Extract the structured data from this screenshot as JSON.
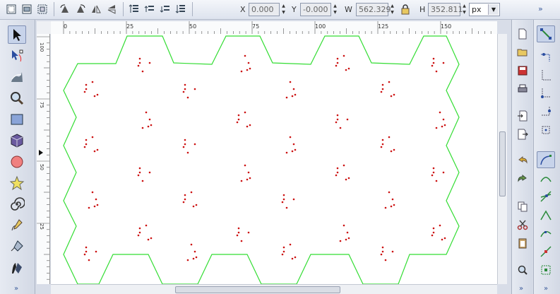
{
  "toolbar": {
    "x_label": "X",
    "x_value": "0.000",
    "y_label": "Y",
    "y_value": "-0.000",
    "w_label": "W",
    "w_value": "562.329",
    "h_label": "H",
    "h_value": "352.811",
    "unit": "px",
    "overflow": "»"
  },
  "ruler": {
    "top_labels": [
      "0",
      "25",
      "50",
      "75",
      "100",
      "125",
      "150"
    ],
    "left_labels": [
      "100",
      "75",
      "50",
      "25"
    ]
  },
  "chevrons": {
    "left": "»",
    "right": "»",
    "snap": "»"
  },
  "colors": {
    "outline": "#33dd33",
    "dots": "#cc1111",
    "canvas": "#ffffff",
    "chrome": "#d8dde8"
  }
}
